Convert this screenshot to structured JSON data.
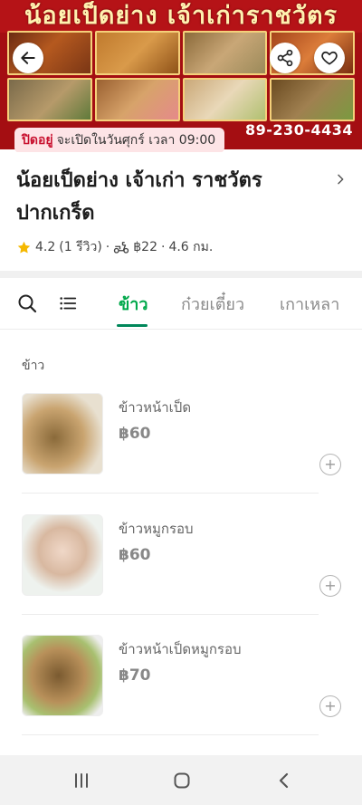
{
  "banner": {
    "title": "น้อยเป็ดย่าง เจ้าเก่าราชวัตร",
    "phone": "89-230-4434"
  },
  "status": {
    "closed": "ปิดอยู่",
    "opens": "จะเปิดในวันศุกร์ เวลา 09:00"
  },
  "store": {
    "name": "น้อยเป็ดย่าง เจ้าเก่า ราชวัตร ปากเกร็ด",
    "rating": "4.2",
    "reviews": "(1 รีวิว)",
    "delivery_fee": "฿22",
    "distance": "4.6 กม.",
    "separator": "·"
  },
  "tabs": [
    "ข้าว",
    "ก๋วยเตี๋ยว",
    "เกาเหลา"
  ],
  "menu": {
    "section": "ข้าว",
    "items": [
      {
        "name": "ข้าวหน้าเป็ด",
        "price": "฿60"
      },
      {
        "name": "ข้าวหมูกรอบ",
        "price": "฿60"
      },
      {
        "name": "ข้าวหน้าเป็ดหมูกรอบ",
        "price": "฿70"
      }
    ],
    "add_label": "+"
  },
  "colors": {
    "accent": "#00a84a",
    "closed_text": "#c8102e",
    "banner": "#a40e12"
  },
  "icons": [
    "back-arrow-icon",
    "share-icon",
    "heart-icon",
    "chevron-right-icon",
    "star-icon",
    "delivery-scooter-icon",
    "search-icon",
    "list-icon",
    "add-icon",
    "recent-apps-icon",
    "home-icon",
    "back-icon"
  ]
}
